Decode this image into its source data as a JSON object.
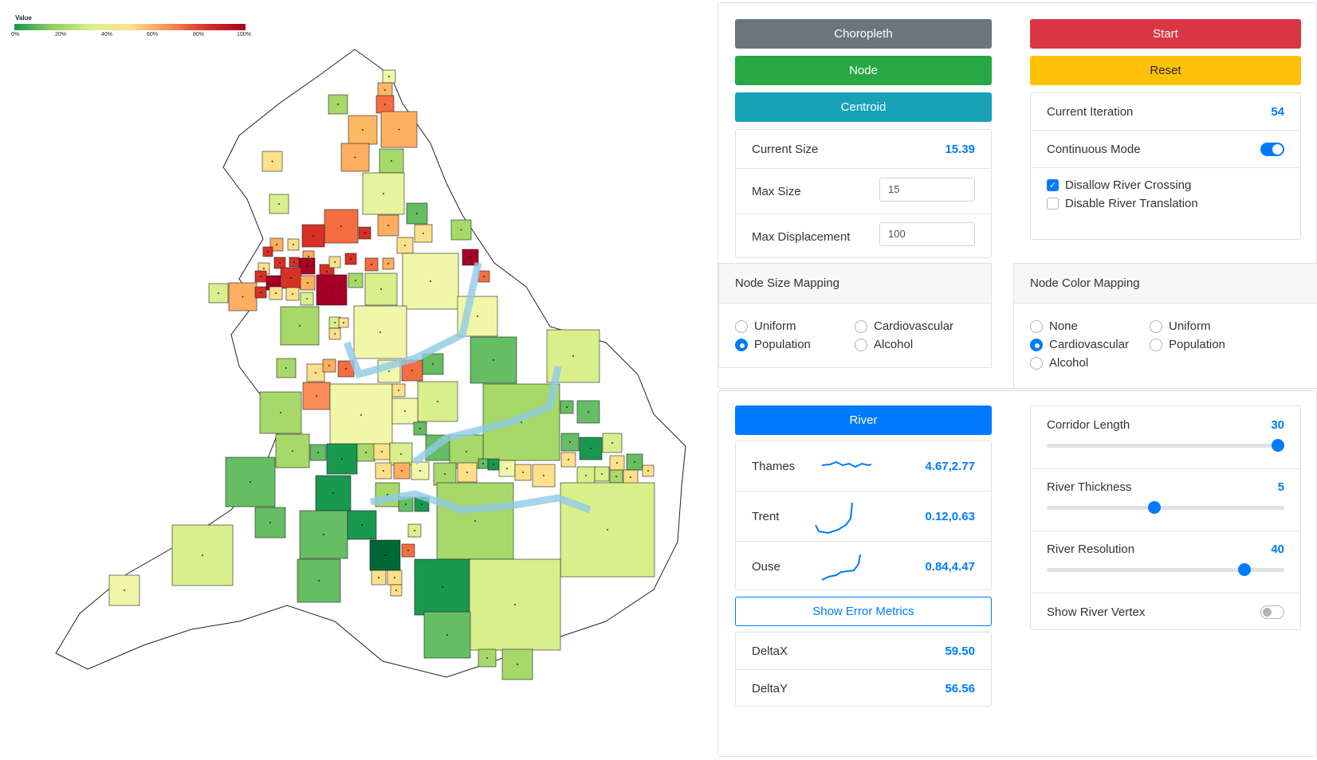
{
  "colors": {
    "accent": "#007bff",
    "choropleth": "#6c757d",
    "node": "#28a745",
    "centroid": "#17a2b8",
    "start": "#dc3545",
    "reset": "#ffc107",
    "river": "#8ecae6"
  },
  "legend": {
    "title": "Value",
    "ticks": [
      "0%",
      "20%",
      "40%",
      "60%",
      "80%",
      "100%"
    ]
  },
  "buttons": {
    "choropleth": "Choropleth",
    "node": "Node",
    "centroid": "Centroid",
    "start": "Start",
    "reset": "Reset",
    "river": "River",
    "error_metrics": "Show Error Metrics"
  },
  "size": {
    "current_label": "Current Size",
    "current_value": "15.39",
    "max_label": "Max Size",
    "max_value": "15",
    "disp_label": "Max Displacement",
    "disp_value": "100"
  },
  "iteration": {
    "label": "Current Iteration",
    "value": "54",
    "continuous_label": "Continuous Mode",
    "continuous_on": true,
    "disallow_label": "Disallow River Crossing",
    "disallow_checked": true,
    "disable_label": "Disable River Translation",
    "disable_checked": false
  },
  "size_mapping": {
    "title": "Node Size Mapping",
    "options": [
      "Uniform",
      "Population",
      "Cardiovascular",
      "Alcohol"
    ],
    "selected": "Population"
  },
  "color_mapping": {
    "title": "Node Color Mapping",
    "options": [
      "None",
      "Cardiovascular",
      "Alcohol",
      "Uniform",
      "Population"
    ],
    "selected": "Cardiovascular"
  },
  "rivers": [
    {
      "name": "Thames",
      "value": "4.67,2.77"
    },
    {
      "name": "Trent",
      "value": "0.12,0.63"
    },
    {
      "name": "Ouse",
      "value": "0.84,4.47"
    }
  ],
  "deltas": [
    {
      "label": "DeltaX",
      "value": "59.50"
    },
    {
      "label": "DeltaY",
      "value": "56.56"
    }
  ],
  "sliders": [
    {
      "label": "Corridor Length",
      "value": "30",
      "fraction": 1.0
    },
    {
      "label": "River Thickness",
      "value": "5",
      "fraction": 0.45
    },
    {
      "label": "River Resolution",
      "value": "40",
      "fraction": 0.85
    }
  ],
  "vertex": {
    "label": "Show River Vertex",
    "on": false
  }
}
